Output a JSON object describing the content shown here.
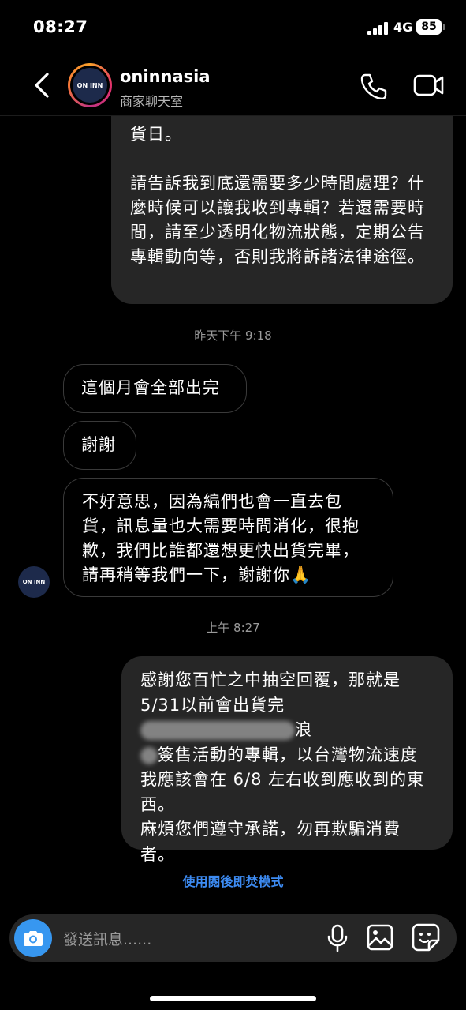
{
  "status_bar": {
    "time": "08:27",
    "network": "4G",
    "battery": "85"
  },
  "header": {
    "name": "oninnasia",
    "subtitle": "商家聊天室",
    "avatar_text": "ON INN"
  },
  "messages": {
    "m1_partial": "貨日。",
    "m1_body": "請告訴我到底還需要多少時間處理？什麼時候可以讓我收到專輯？若還需要時間，請至少透明化物流狀態，定期公告專輯動向等，否則我將訴諸法律途徑。",
    "ts1": "昨天下午 9:18",
    "r1": "這個月會全部出完",
    "r2": "謝謝",
    "r3": "不好意思，因為編們也會一直去包貨，訊息量也大需要時間消化，很抱歉，我們比誰都還想更快出貨完畢，請再稍等我們一下，謝謝你🙏",
    "ts2": "上午 8:27",
    "m2_line1": "感謝您百忙之中抽空回覆，那就是",
    "m2_line2a": "5/31以前會出貨完",
    "m2_line2b": "浪",
    "m2_line3": "簽售活動的專輯，以台灣物流速度",
    "m2_line4": "我應該會在 6/8 左右收到應收到的東",
    "m2_line5": "西。",
    "m2_line6": "麻煩您們遵守承諾，勿再欺騙消費",
    "m2_line7": "者。"
  },
  "vanish_mode": "使用閱後即焚模式",
  "composer": {
    "placeholder": "發送訊息......"
  },
  "colors": {
    "accent": "#3797f0",
    "link": "#3d8bf2",
    "bubble_me": "#262626"
  }
}
